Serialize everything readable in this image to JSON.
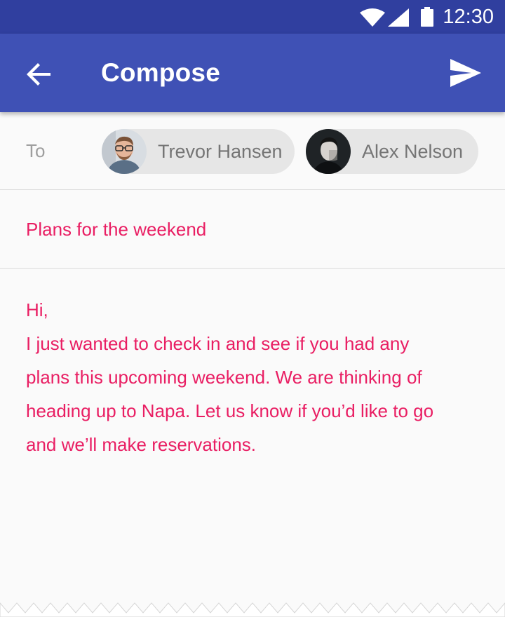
{
  "status_bar": {
    "time": "12:30",
    "icons": [
      "wifi-icon",
      "cellular-signal-icon",
      "battery-icon"
    ]
  },
  "app_bar": {
    "title": "Compose",
    "back_icon": "arrow-back-icon",
    "send_icon": "send-icon",
    "color": "#3f51b5",
    "status_color": "#303f9f"
  },
  "compose": {
    "to_label": "To",
    "recipients": [
      {
        "name": "Trevor Hansen",
        "avatar": "avatar-photo-man-glasses"
      },
      {
        "name": "Alex Nelson",
        "avatar": "avatar-photo-man-dark"
      }
    ],
    "subject": "Plans for the weekend",
    "body_lines": [
      "Hi,",
      "I just wanted to check in and see if you had any",
      "plans this upcoming weekend. We are thinking of",
      "heading up to Napa. Let us know if you’d like to go",
      "and we’ll make reservations."
    ],
    "accent_color": "#e91e63"
  }
}
